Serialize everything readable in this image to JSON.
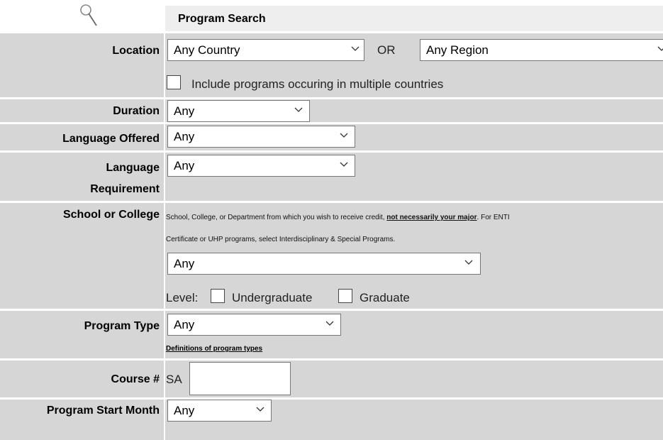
{
  "header": {
    "title": "Program Search",
    "icon": "magnifier-icon"
  },
  "location": {
    "label": "Location",
    "country_value": "Any Country",
    "or_text": "OR",
    "region_value": "Any Region",
    "multi_country_label": "Include programs occuring in multiple countries"
  },
  "duration": {
    "label": "Duration",
    "value": "Any"
  },
  "language_offered": {
    "label": "Language Offered",
    "value": "Any"
  },
  "language_requirement": {
    "label_line1": "Language",
    "label_line2": "Requirement",
    "value": "Any"
  },
  "school": {
    "label": "School or College",
    "help_part1": "School, College, or Department from which you wish to receive credit, ",
    "help_bold": "not necessarily your major",
    "help_part2": ". For ENTI",
    "help_line2": "Certificate or UHP programs, select Interdisciplinary & Special Programs.",
    "value": "Any",
    "level_label": "Level:",
    "undergrad_label": "Undergraduate",
    "grad_label": "Graduate"
  },
  "program_type": {
    "label": "Program Type",
    "value": "Any",
    "definitions_link": "Definitions of program types"
  },
  "course": {
    "label": "Course #",
    "prefix": "SA",
    "value": ""
  },
  "start_month": {
    "label": "Program Start Month",
    "value": "Any"
  },
  "colors": {
    "cell_bg": "#d6d6d6",
    "header_bg": "#eeeeee",
    "border": "#767676"
  }
}
